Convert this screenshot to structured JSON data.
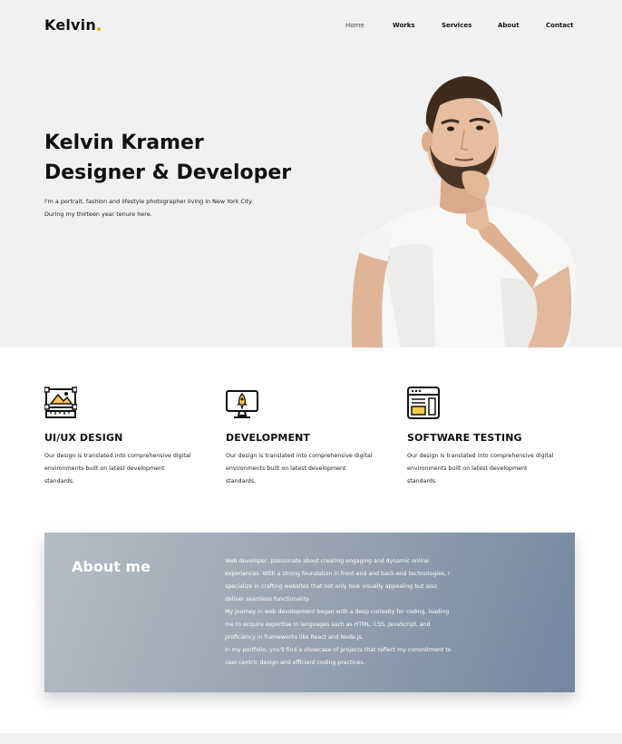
{
  "brand": {
    "name": "Kelvin",
    "accent": "#f5a623"
  },
  "nav": {
    "items": [
      "Home",
      "Works",
      "Services",
      "About",
      "Contact"
    ],
    "active": "Home"
  },
  "hero": {
    "title_line1": "Kelvin Kramer",
    "title_line2": "Designer & Developer",
    "text_line1": "I'm a portrait, fashion and lifestyle photographer living in New York City.",
    "text_line2": "During my thirteen year tenure here."
  },
  "services": [
    {
      "icon": "design-board-icon",
      "title": "UI/UX DESIGN",
      "lines": [
        "Our design is translated into comprehensive digital",
        "environments built on latest development",
        "standards."
      ]
    },
    {
      "icon": "monitor-rocket-icon",
      "title": "DEVELOPMENT",
      "lines": [
        "Our design is translated into comprehensive digital",
        "environments built on latest development",
        "standards."
      ]
    },
    {
      "icon": "browser-layout-icon",
      "title": "SOFTWARE TESTING",
      "lines": [
        "Our design is translated into comprehensive digital",
        "environments built on latest development",
        "standards."
      ]
    }
  ],
  "about": {
    "title": "About me",
    "lines": [
      "Web developer, passionate about creating engaging and dynamic online",
      "experiences. With a strong foundation in front-end and back-end technologies, I",
      "specialize in crafting websites that not only look visually appealing but also",
      "deliver seamless functionality.",
      "My journey in web development began with a deep curiosity for coding, leading",
      "me to acquire expertise in languages such as HTML, CSS, JavaScript, and",
      "proficiency in frameworks like React and Node.js.",
      "In my portfolio, you'll find a showcase of projects that reflect my commitment to",
      "user-centric design and efficient coding practices."
    ]
  },
  "colors": {
    "hero_bg": "#f1f1f1",
    "text": "#111111",
    "about_start": "#b6bcc5",
    "about_end": "#73879f",
    "icon_yellow": "#f7c948"
  }
}
